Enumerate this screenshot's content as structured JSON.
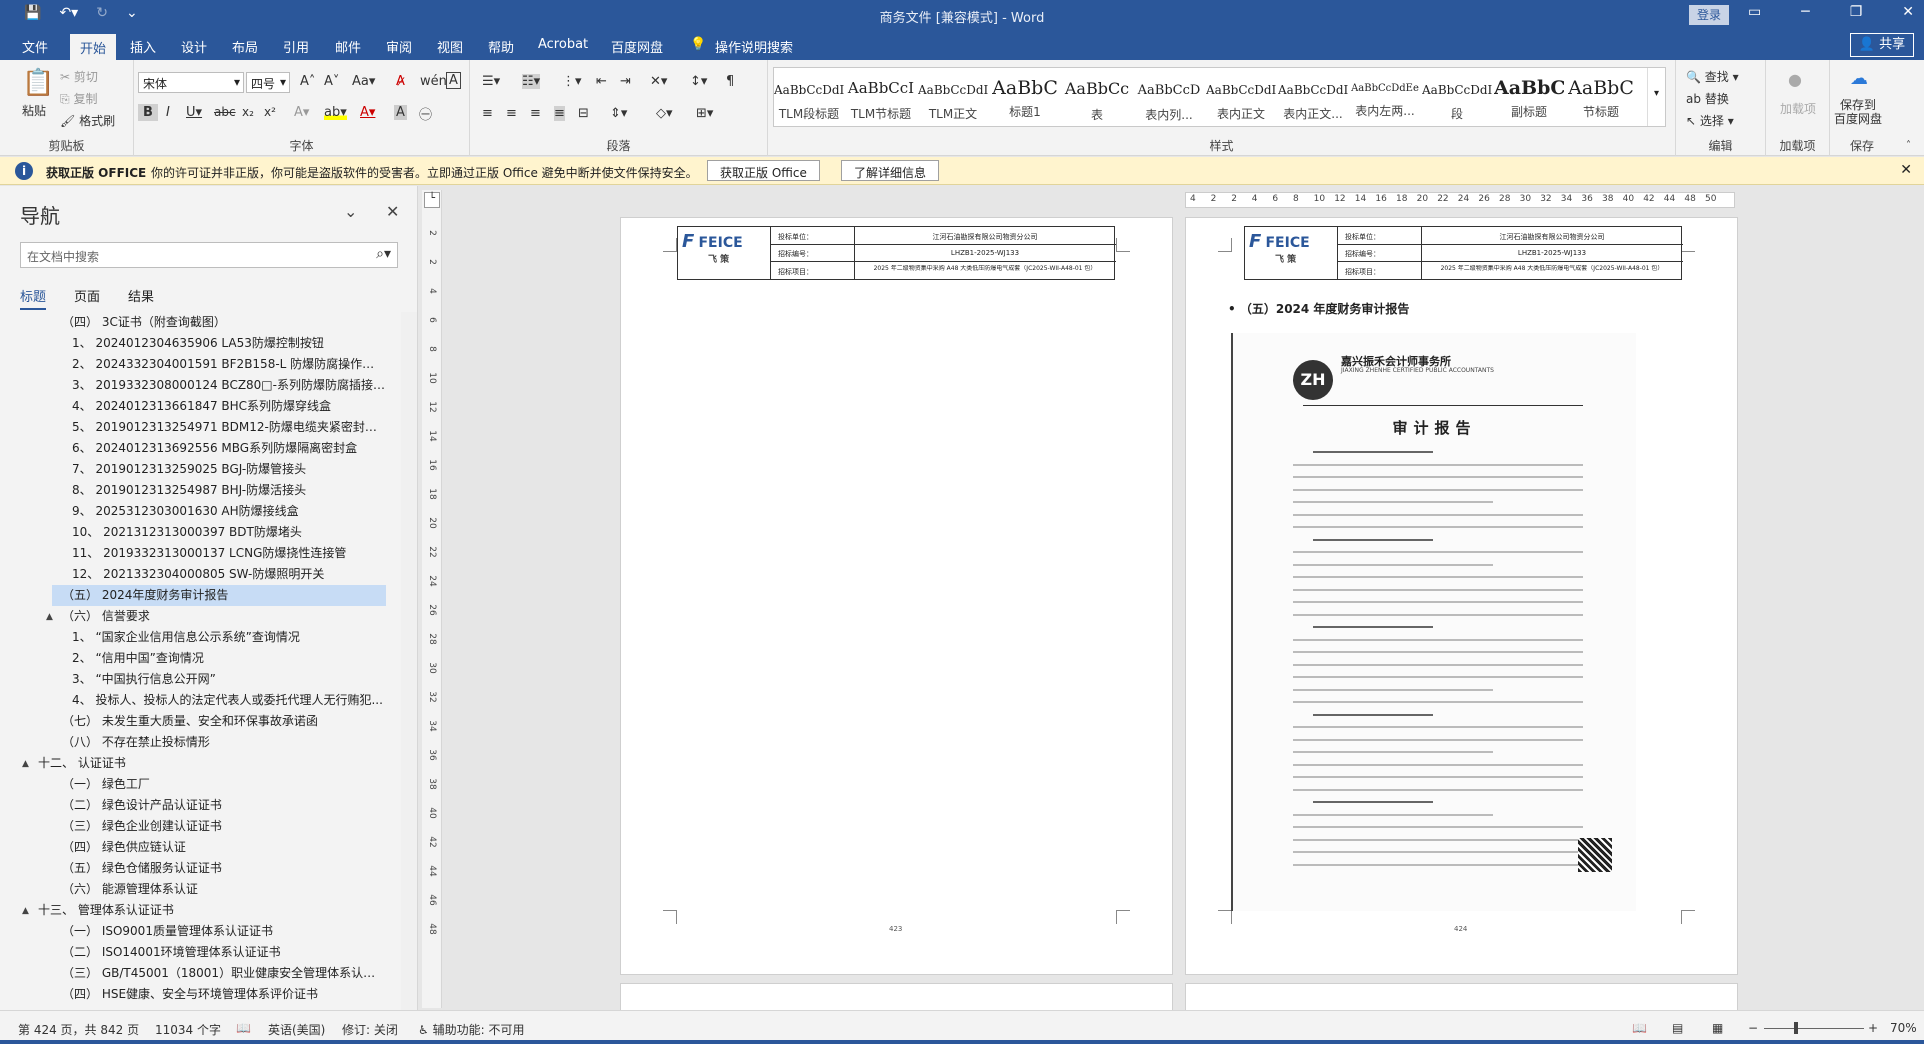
{
  "titlebar": {
    "title": "商务文件 [兼容模式] - Word",
    "login": "登录"
  },
  "tabs": [
    "文件",
    "开始",
    "插入",
    "设计",
    "布局",
    "引用",
    "邮件",
    "审阅",
    "视图",
    "帮助",
    "Acrobat",
    "百度网盘"
  ],
  "tell_me": "操作说明搜索",
  "share": "共享",
  "ribbon": {
    "paste": "粘贴",
    "cut": "剪切",
    "copy": "复制",
    "format_painter": "格式刷",
    "clipboard_label": "剪贴板",
    "font_name": "宋体",
    "font_size": "四号",
    "font_label": "字体",
    "paragraph_label": "段落",
    "styles_label": "样式",
    "find": "查找",
    "replace": "替换",
    "select": "选择",
    "edit_label": "编辑",
    "addin": "加载项",
    "addin_label": "加载项",
    "save_baidu": "保存到\n百度网盘",
    "save_label": "保存",
    "styles": [
      {
        "sample": "AaBbCcDdI",
        "name": "TLM段标题"
      },
      {
        "sample": "AaBbCcI",
        "name": "TLM节标题"
      },
      {
        "sample": "AaBbCcDdI",
        "name": "TLM正文"
      },
      {
        "sample": "AaBbC",
        "name": "标题1"
      },
      {
        "sample": "AaBbCc",
        "name": "表"
      },
      {
        "sample": "AaBbCcD",
        "name": "表内列..."
      },
      {
        "sample": "AaBbCcDdI",
        "name": "表内正文"
      },
      {
        "sample": "AaBbCcDdI",
        "name": "表内正文..."
      },
      {
        "sample": "AaBbCcDdEe",
        "name": "表内左两..."
      },
      {
        "sample": "AaBbCcDdI",
        "name": "段"
      },
      {
        "sample": "AaBbC",
        "name": "副标题"
      },
      {
        "sample": "AaBbC",
        "name": "节标题"
      }
    ]
  },
  "infobar": {
    "title": "获取正版 OFFICE",
    "message": "你的许可证并非正版，你可能是盗版软件的受害者。立即通过正版 Office 避免中断并使文件保持安全。",
    "btn_get": "获取正版 Office",
    "btn_more": "了解详细信息"
  },
  "nav": {
    "title": "导航",
    "search_placeholder": "在文档中搜索",
    "tabs": [
      "标题",
      "页面",
      "结果"
    ],
    "items": [
      {
        "text": "（四） 3C证书（附查询截图）",
        "indent": 2
      },
      {
        "text": "1、 2024012304635906 LA53防爆控制按钮",
        "indent": 3
      },
      {
        "text": "2、 2024332304001591 BF2B158-L 防爆防腐操作柱（...",
        "indent": 3
      },
      {
        "text": "3、 2019332308000124 BCZ80□-系列防爆防腐插接装置",
        "indent": 3
      },
      {
        "text": "4、 2024012313661847 BHC系列防爆穿线盒",
        "indent": 3
      },
      {
        "text": "5、 2019012313254971 BDM12-防爆电缆夹紧密封接头",
        "indent": 3
      },
      {
        "text": "6、 2024012313692556 MBG系列防爆隔离密封盒",
        "indent": 3
      },
      {
        "text": "7、 2019012313259025 BGJ-防爆管接头",
        "indent": 3
      },
      {
        "text": "8、 2019012313254987 BHJ-防爆活接头",
        "indent": 3
      },
      {
        "text": "9、 2025312303001630 AH防爆接线盒",
        "indent": 3
      },
      {
        "text": "10、 2021312313000397 BDT防爆堵头",
        "indent": 3
      },
      {
        "text": "11、 2019332313000137 LCNG防爆挠性连接管",
        "indent": 3
      },
      {
        "text": "12、 2021332304000805 SW-防爆照明开关",
        "indent": 3
      },
      {
        "text": "（五） 2024年度财务审计报告",
        "indent": 2,
        "selected": true
      },
      {
        "text": "（六） 信誉要求",
        "indent": 2,
        "caret": "▲"
      },
      {
        "text": "1、 “国家企业信用信息公示系统”查询情况",
        "indent": 3
      },
      {
        "text": "2、 “信用中国”查询情况",
        "indent": 3
      },
      {
        "text": "3、 “中国执行信息公开网”",
        "indent": 3
      },
      {
        "text": "4、 投标人、投标人的法定代表人或委托代理人无行贿犯...",
        "indent": 3
      },
      {
        "text": "（七） 未发生重大质量、安全和环保事故承诺函",
        "indent": 2
      },
      {
        "text": "（八） 不存在禁止投标情形",
        "indent": 2
      },
      {
        "text": "十二、 认证证书",
        "indent": 1,
        "caret": "▲"
      },
      {
        "text": "（一） 绿色工厂",
        "indent": 2
      },
      {
        "text": "（二） 绿色设计产品认证证书",
        "indent": 2
      },
      {
        "text": "（三） 绿色企业创建认证证书",
        "indent": 2
      },
      {
        "text": "（四） 绿色供应链认证",
        "indent": 2
      },
      {
        "text": "（五） 绿色仓储服务认证证书",
        "indent": 2
      },
      {
        "text": "（六） 能源管理体系认证",
        "indent": 2
      },
      {
        "text": "十三、 管理体系认证证书",
        "indent": 1,
        "caret": "▲"
      },
      {
        "text": "（一） ISO9001质量管理体系认证证书",
        "indent": 2
      },
      {
        "text": "（二） ISO14001环境管理体系认证证书",
        "indent": 2
      },
      {
        "text": "（三） GB/T45001（18001）职业健康安全管理体系认证...",
        "indent": 2
      },
      {
        "text": "（四） HSE健康、安全与环境管理体系评价证书",
        "indent": 2
      }
    ]
  },
  "hruler": [
    "4",
    "2",
    "2",
    "4",
    "6",
    "8",
    "10",
    "12",
    "14",
    "16",
    "18",
    "20",
    "22",
    "24",
    "26",
    "28",
    "30",
    "32",
    "34",
    "36",
    "38",
    "40",
    "42",
    "44",
    "48",
    "50"
  ],
  "vruler": [
    "2",
    "2",
    "4",
    "6",
    "8",
    "10",
    "12",
    "14",
    "16",
    "18",
    "20",
    "22",
    "24",
    "26",
    "28",
    "30",
    "32",
    "34",
    "36",
    "38",
    "40",
    "42",
    "44",
    "46",
    "48"
  ],
  "pages": {
    "header_logo": "FEICE",
    "header_logo_cn": "飞 策",
    "header_rows": [
      {
        "label": "投标单位：",
        "value": "江河石油勘探有限公司物资分公司"
      },
      {
        "label": "招标编号：",
        "value": "LHZB1-2025-WJ133"
      },
      {
        "label": "招标项目：",
        "value": "2025 年二级物资集中采购 A48 大类低压防爆电气成套（JC2025-WII-A48-01 包）"
      }
    ],
    "left_page_num": "423",
    "right_page_num": "424",
    "section_heading": "（五）2024 年度财务审计报告",
    "scan_firm": "嘉兴振禾会计师事务所",
    "scan_firm_en": "JIAXING ZHENHE CERTIFIED PUBLIC ACCOUNTANTS",
    "scan_badge": "ZH",
    "scan_title": "审计报告"
  },
  "status": {
    "page": "第 424 页，共 842 页",
    "words": "11034 个字",
    "lang": "英语(美国)",
    "track": "修订: 关闭",
    "access": "辅助功能: 不可用",
    "zoom": "70%"
  }
}
